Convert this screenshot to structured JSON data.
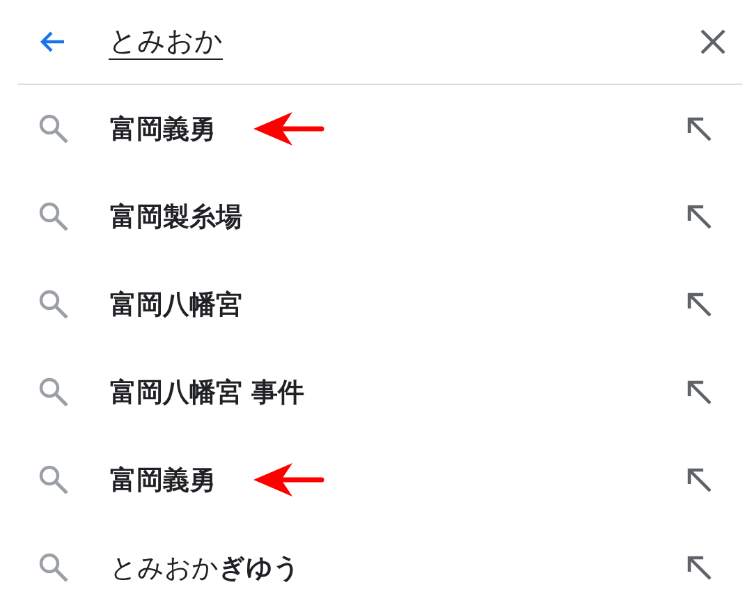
{
  "search_bar": {
    "query": "とみおか"
  },
  "suggestions": [
    {
      "text": "富岡義勇",
      "bold": true,
      "marked": true
    },
    {
      "text": "富岡製糸場",
      "bold": true,
      "marked": false
    },
    {
      "text": "富岡八幡宮",
      "bold": true,
      "marked": false
    },
    {
      "text": "富岡八幡宮 事件",
      "bold": true,
      "marked": false
    },
    {
      "text": "富岡義勇",
      "bold": true,
      "marked": true
    },
    {
      "text": "とみおか**ぎゆう**",
      "bold": false,
      "marked": false
    }
  ]
}
